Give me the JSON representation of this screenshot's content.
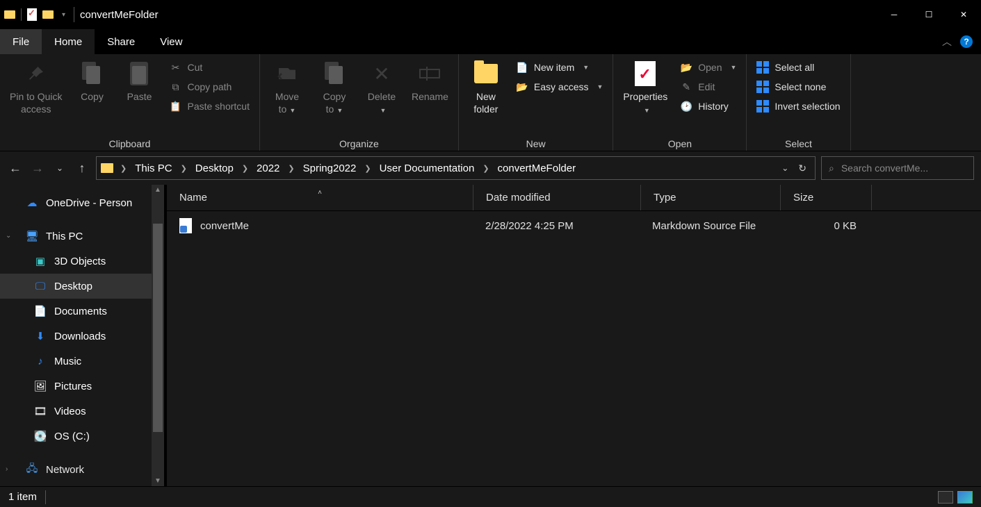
{
  "window": {
    "title": "convertMeFolder"
  },
  "tabs": {
    "file": "File",
    "home": "Home",
    "share": "Share",
    "view": "View"
  },
  "ribbon": {
    "clipboard": {
      "label": "Clipboard",
      "pin": "Pin to Quick\naccess",
      "copy": "Copy",
      "paste": "Paste",
      "cut": "Cut",
      "copy_path": "Copy path",
      "paste_shortcut": "Paste shortcut"
    },
    "organize": {
      "label": "Organize",
      "move_to": "Move\nto",
      "copy_to": "Copy\nto",
      "delete": "Delete",
      "rename": "Rename"
    },
    "new": {
      "label": "New",
      "new_folder": "New\nfolder",
      "new_item": "New item",
      "easy_access": "Easy access"
    },
    "open": {
      "label": "Open",
      "properties": "Properties",
      "open": "Open",
      "edit": "Edit",
      "history": "History"
    },
    "select": {
      "label": "Select",
      "select_all": "Select all",
      "select_none": "Select none",
      "invert": "Invert selection"
    }
  },
  "breadcrumbs": [
    "This PC",
    "Desktop",
    "2022",
    "Spring2022",
    "User Documentation",
    "convertMeFolder"
  ],
  "search": {
    "placeholder": "Search convertMe..."
  },
  "nav_pane": {
    "onedrive": "OneDrive - Person",
    "this_pc": "This PC",
    "items": [
      "3D Objects",
      "Desktop",
      "Documents",
      "Downloads",
      "Music",
      "Pictures",
      "Videos",
      "OS (C:)"
    ],
    "network": "Network"
  },
  "columns": {
    "name": "Name",
    "date": "Date modified",
    "type": "Type",
    "size": "Size"
  },
  "files": [
    {
      "name": "convertMe",
      "date": "2/28/2022 4:25 PM",
      "type": "Markdown Source File",
      "size": "0 KB"
    }
  ],
  "status": {
    "count": "1 item"
  }
}
